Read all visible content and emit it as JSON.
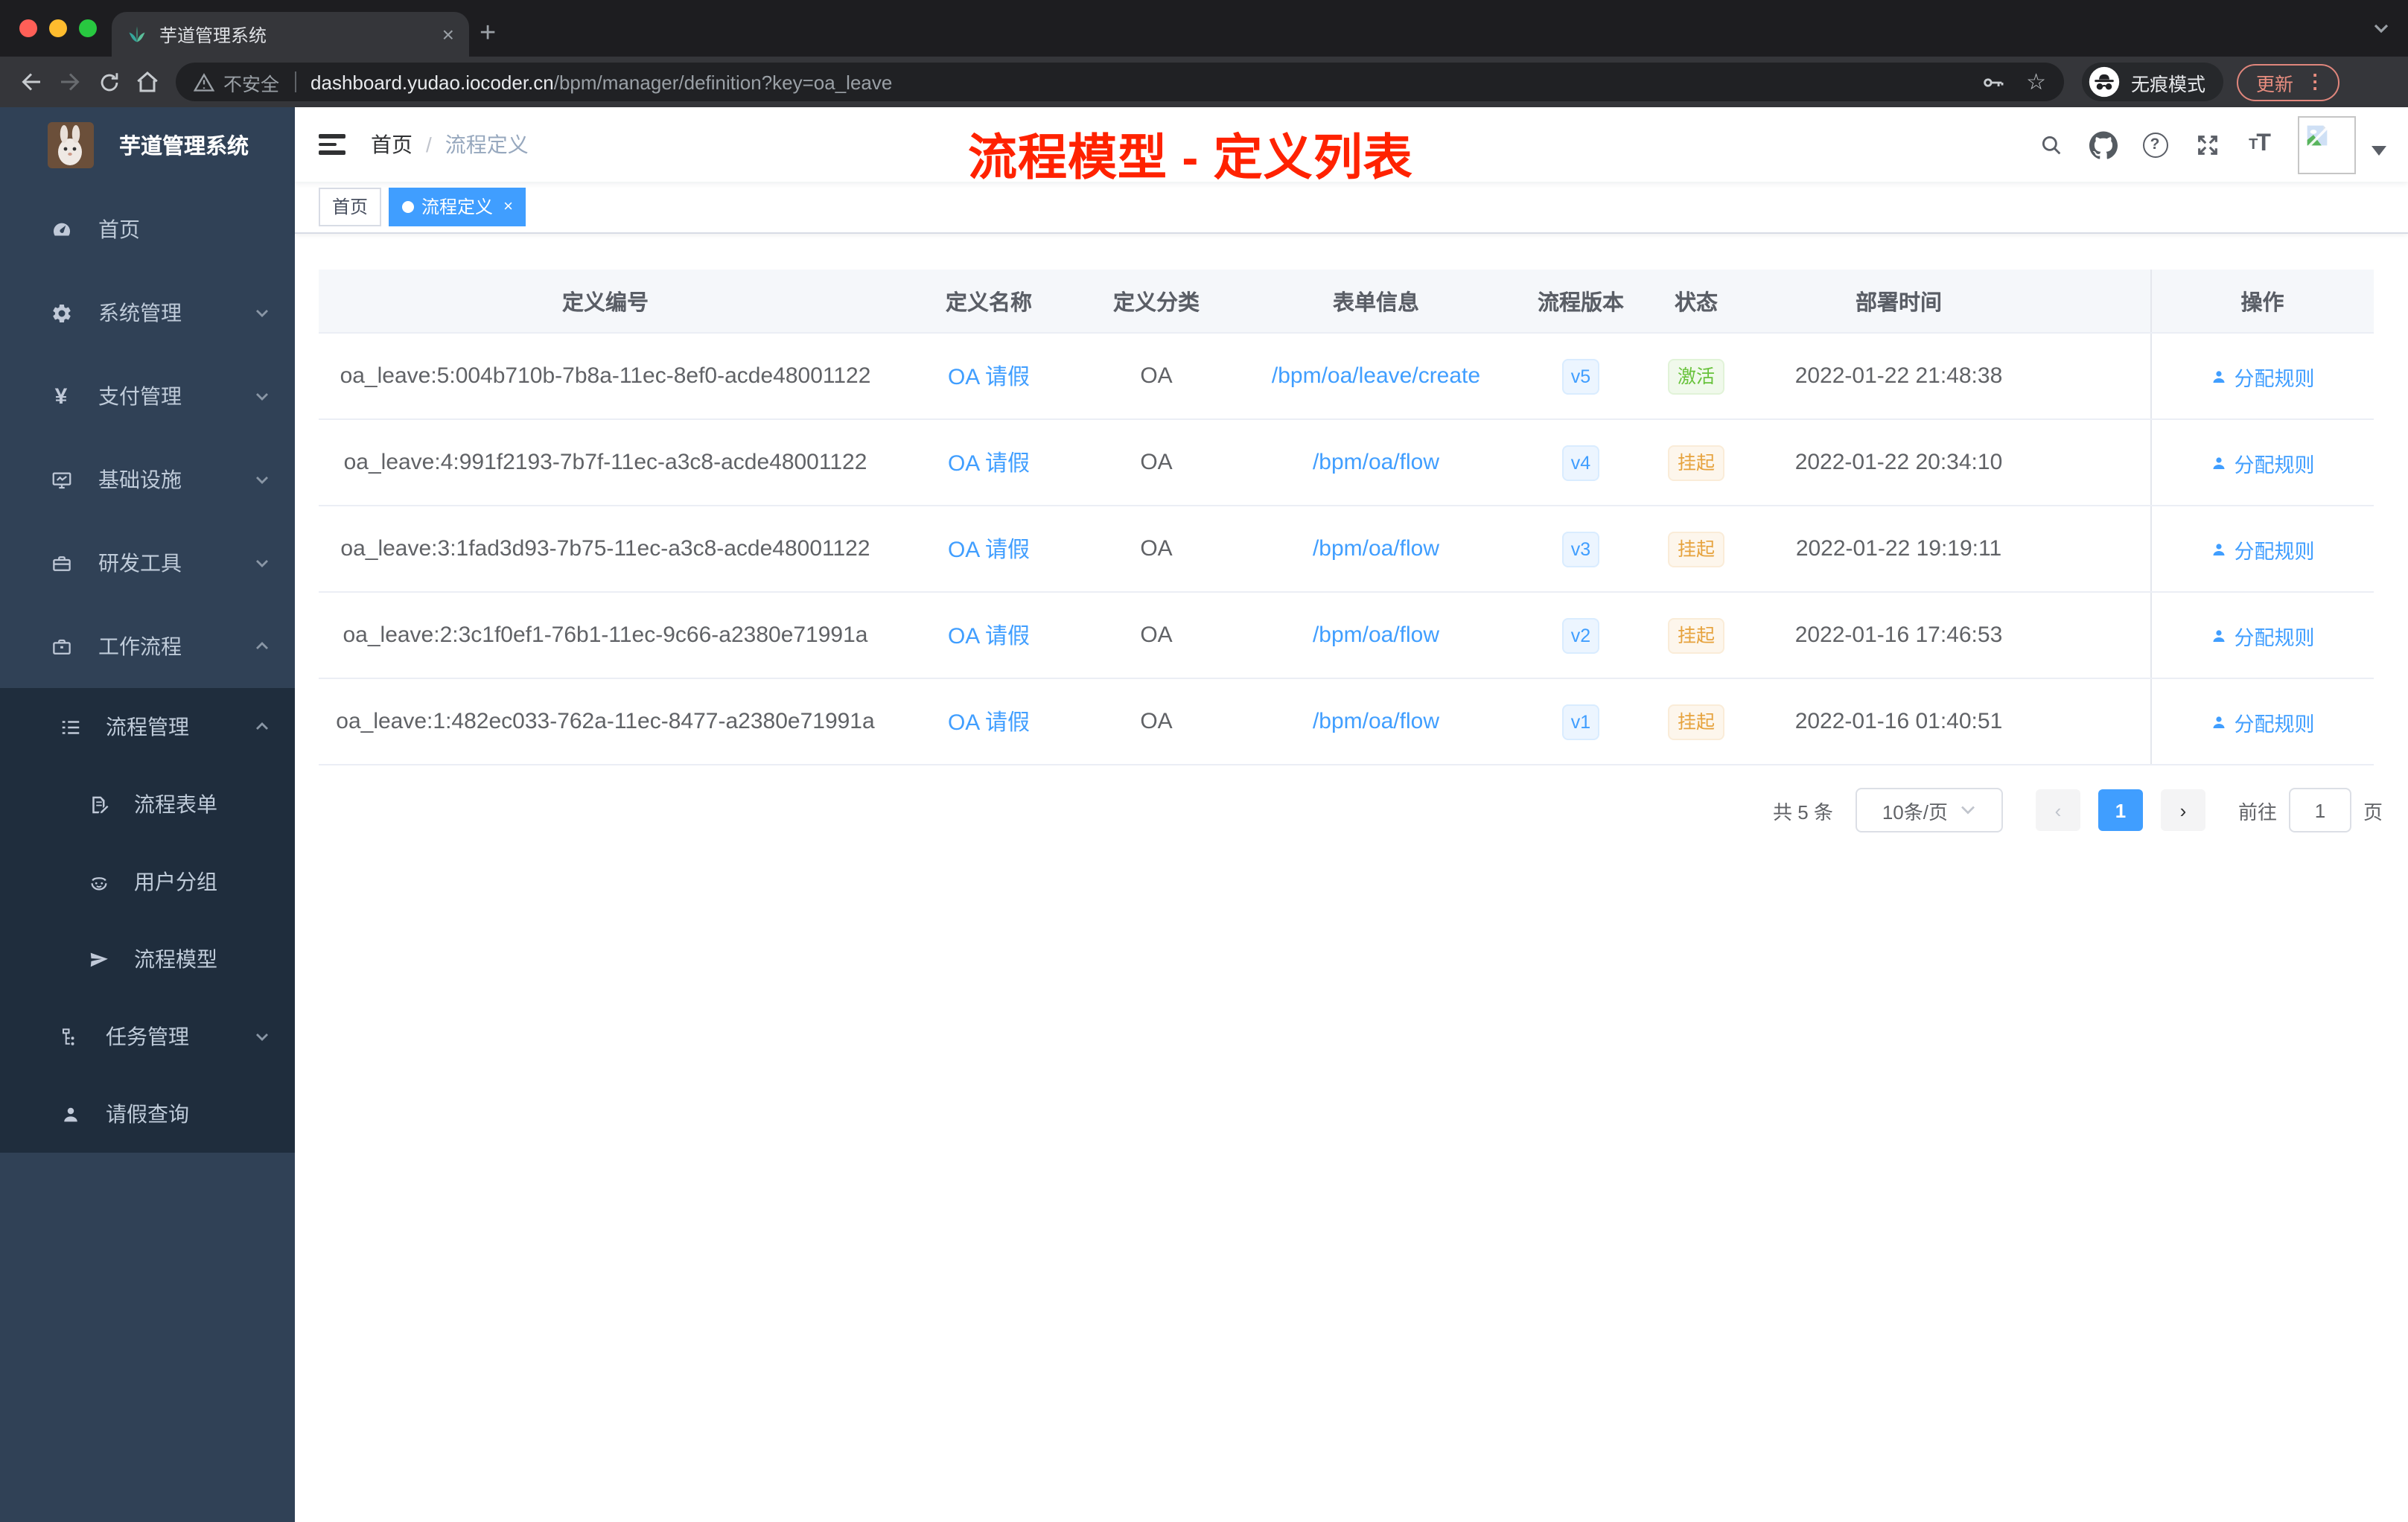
{
  "colors": {
    "accent_blue": "#409eff",
    "sidebar_bg": "#304156",
    "submenu_bg": "#1f2d3d",
    "success_green": "#67c23a",
    "warning_orange": "#e6a23c",
    "annotation_red": "#ff2200",
    "update_button": "#e88d7f"
  },
  "icons": {
    "close": "×",
    "plus": "+",
    "more_vertical": "⋮",
    "question": "?",
    "star": "☆",
    "chevron_left": "‹",
    "chevron_right": "›",
    "font_small": "T",
    "font_large": "T",
    "yen": "¥"
  },
  "browser": {
    "tab_title": "芋道管理系统",
    "security_label": "不安全",
    "url_host": "dashboard.yudao.iocoder.cn",
    "url_path": "/bpm/manager/definition?key=oa_leave",
    "incognito_label": "无痕模式",
    "update_label": "更新"
  },
  "sidebar": {
    "brand": "芋道管理系统",
    "items": [
      {
        "label": "首页"
      },
      {
        "label": "系统管理"
      },
      {
        "label": "支付管理"
      },
      {
        "label": "基础设施"
      },
      {
        "label": "研发工具"
      },
      {
        "label": "工作流程"
      }
    ],
    "submenu": {
      "items": [
        {
          "label": "流程管理"
        },
        {
          "label": "流程表单"
        },
        {
          "label": "用户分组"
        },
        {
          "label": "流程模型"
        },
        {
          "label": "任务管理"
        },
        {
          "label": "请假查询"
        }
      ]
    }
  },
  "navbar": {
    "breadcrumb_home": "首页",
    "breadcrumb_sep": "/",
    "breadcrumb_current": "流程定义"
  },
  "overlay_title": "流程模型 - 定义列表",
  "tags": [
    {
      "label": "首页"
    },
    {
      "label": "流程定义"
    }
  ],
  "table": {
    "columns": [
      "定义编号",
      "定义名称",
      "定义分类",
      "表单信息",
      "流程版本",
      "状态",
      "部署时间",
      "操作"
    ],
    "rows": [
      {
        "id": "oa_leave:5:004b710b-7b8a-11ec-8ef0-acde48001122",
        "name": "OA 请假",
        "category": "OA",
        "form": "/bpm/oa/leave/create",
        "version": "v5",
        "status": "激活",
        "time": "2022-01-22 21:48:38",
        "action": "分配规则"
      },
      {
        "id": "oa_leave:4:991f2193-7b7f-11ec-a3c8-acde48001122",
        "name": "OA 请假",
        "category": "OA",
        "form": "/bpm/oa/flow",
        "version": "v4",
        "status": "挂起",
        "time": "2022-01-22 20:34:10",
        "action": "分配规则"
      },
      {
        "id": "oa_leave:3:1fad3d93-7b75-11ec-a3c8-acde48001122",
        "name": "OA 请假",
        "category": "OA",
        "form": "/bpm/oa/flow",
        "version": "v3",
        "status": "挂起",
        "time": "2022-01-22 19:19:11",
        "action": "分配规则"
      },
      {
        "id": "oa_leave:2:3c1f0ef1-76b1-11ec-9c66-a2380e71991a",
        "name": "OA 请假",
        "category": "OA",
        "form": "/bpm/oa/flow",
        "version": "v2",
        "status": "挂起",
        "time": "2022-01-16 17:46:53",
        "action": "分配规则"
      },
      {
        "id": "oa_leave:1:482ec033-762a-11ec-8477-a2380e71991a",
        "name": "OA 请假",
        "category": "OA",
        "form": "/bpm/oa/flow",
        "version": "v1",
        "status": "挂起",
        "time": "2022-01-16 01:40:51",
        "action": "分配规则"
      }
    ]
  },
  "pagination": {
    "total": "共 5 条",
    "page_size": "10条/页",
    "current_page": "1",
    "goto_label": "前往",
    "page_unit": "页"
  }
}
